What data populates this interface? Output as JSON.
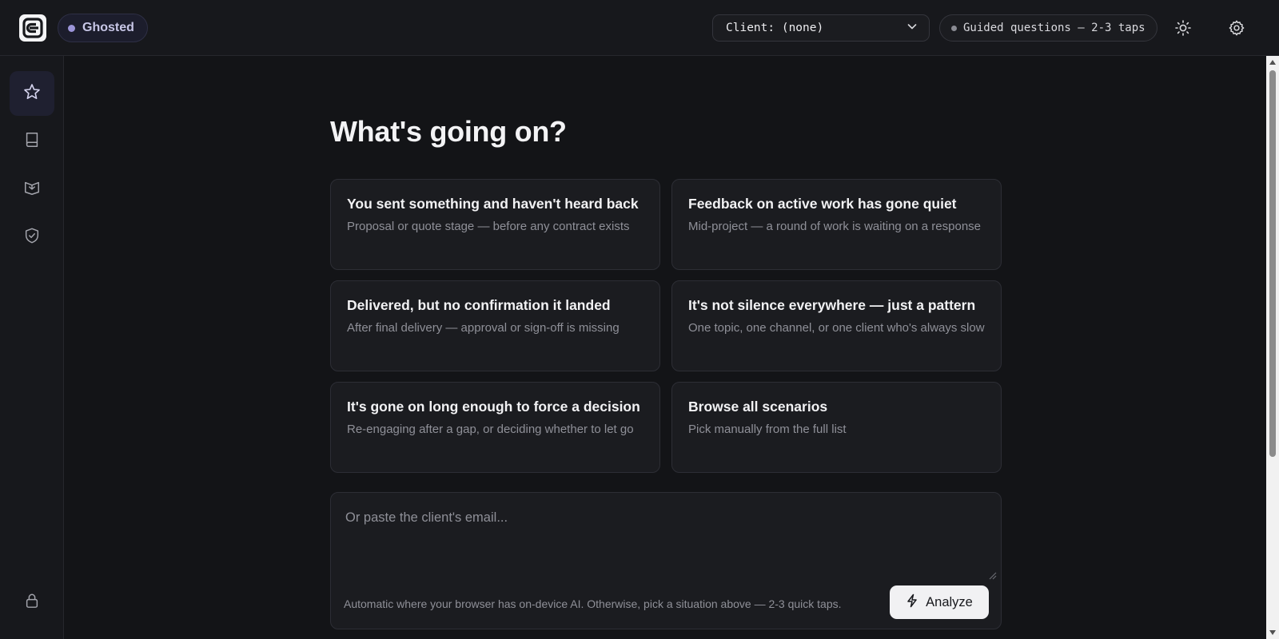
{
  "header": {
    "mode_label": "Ghosted",
    "client_select_label": "Client: (none)",
    "guided_label": "Guided questions — 2-3 taps"
  },
  "icons": {
    "logo": "app-logo-icon",
    "theme": "sun-icon",
    "settings": "gear-icon",
    "sidebar": [
      "star-icon",
      "book-icon",
      "open-book-icon",
      "shield-check-icon"
    ],
    "lock": "lock-icon",
    "analyze": "lightning-icon"
  },
  "colors": {
    "background": "#131417",
    "panel": "#17181c",
    "card": "#1b1c20",
    "accent": "#9c95d9",
    "button": "#f1f1f3"
  },
  "main": {
    "title": "What's going on?",
    "cards": [
      {
        "title": "You sent something and haven't heard back",
        "desc": "Proposal or quote stage — before any contract exists"
      },
      {
        "title": "Feedback on active work has gone quiet",
        "desc": "Mid-project — a round of work is waiting on a response"
      },
      {
        "title": "Delivered, but no confirmation it landed",
        "desc": "After final delivery — approval or sign-off is missing"
      },
      {
        "title": "It's not silence everywhere — just a pattern",
        "desc": "One topic, one channel, or one client who's always slow"
      },
      {
        "title": "It's gone on long enough to force a decision",
        "desc": "Re-engaging after a gap, or deciding whether to let go"
      },
      {
        "title": "Browse all scenarios",
        "desc": "Pick manually from the full list"
      }
    ],
    "paste": {
      "placeholder": "Or paste the client's email...",
      "hint": "Automatic where your browser has on-device AI. Otherwise, pick a situation above — 2-3 quick taps.",
      "analyze_label": "Analyze"
    }
  }
}
